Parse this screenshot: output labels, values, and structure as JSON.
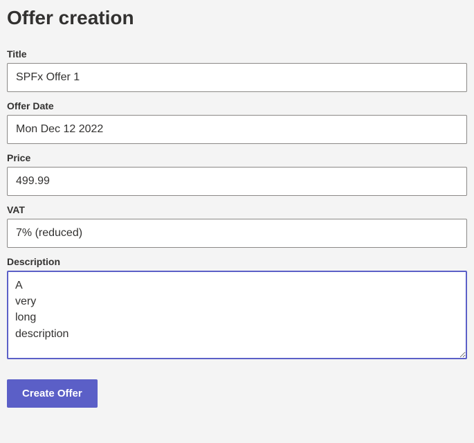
{
  "page": {
    "title": "Offer creation"
  },
  "form": {
    "title": {
      "label": "Title",
      "value": "SPFx Offer 1"
    },
    "offerDate": {
      "label": "Offer Date",
      "value": "Mon Dec 12 2022"
    },
    "price": {
      "label": "Price",
      "value": "499.99"
    },
    "vat": {
      "label": "VAT",
      "value": "7% (reduced)"
    },
    "description": {
      "label": "Description",
      "value": "A\nvery\nlong\ndescription"
    },
    "submit": {
      "label": "Create Offer"
    }
  }
}
